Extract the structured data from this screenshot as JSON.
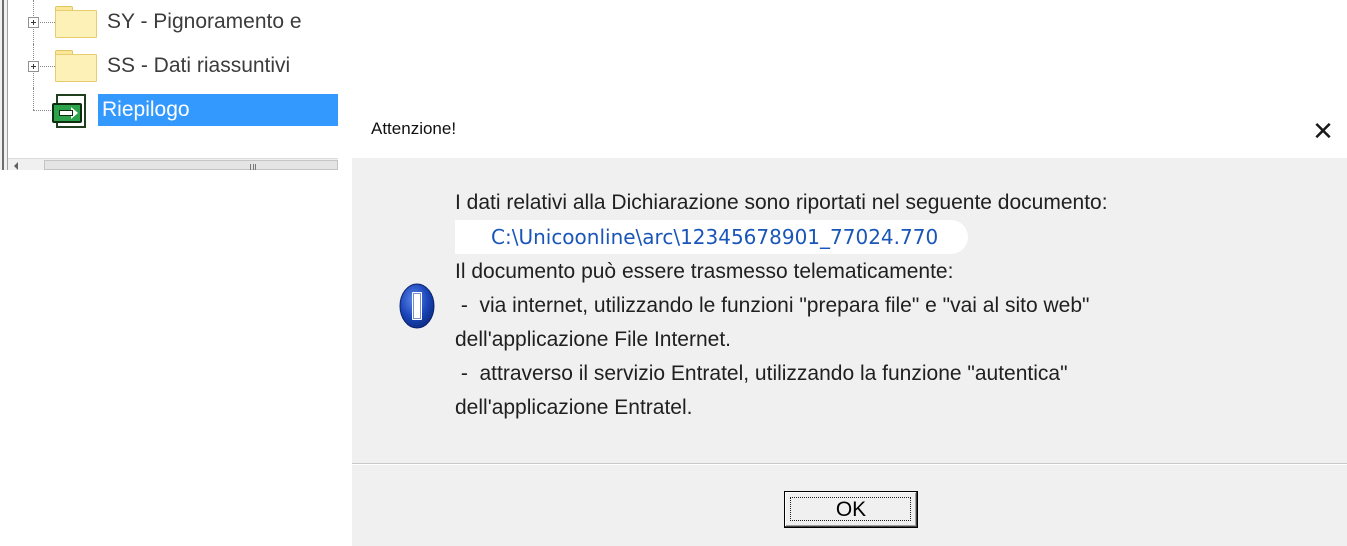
{
  "tree": {
    "items": [
      {
        "label": "SY - Pignoramento e",
        "icon": "folder-icon",
        "expandable": true,
        "selected": false
      },
      {
        "label": "SS - Dati riassuntivi",
        "icon": "folder-icon",
        "expandable": true,
        "selected": false
      },
      {
        "label": "Riepilogo",
        "icon": "document-arrow-icon",
        "expandable": false,
        "selected": true
      }
    ],
    "scroll_grip": "III"
  },
  "dialog": {
    "title": "Attenzione!",
    "close_label": "✕",
    "icon": "information-icon",
    "message": {
      "line1": "I dati relativi alla Dichiarazione sono riportati nel seguente documento:",
      "path": "C:\\Unicoonline\\arc\\12345678901_77024.770",
      "line3": "Il documento può essere trasmesso telematicamente:",
      "line4": " -  via internet, utilizzando le funzioni \"prepara file\" e \"vai al sito web\"",
      "line5": "dell'applicazione File Internet.",
      "line6": " -  attraverso il servizio Entratel, utilizzando la funzione \"autentica\"",
      "line7": "dell'applicazione Entratel."
    },
    "ok_label": "OK"
  },
  "colors": {
    "selection": "#3399ff",
    "dialog_bg": "#f0f0f0",
    "path_text": "#1956b8",
    "info_icon": "#1a45b8"
  }
}
